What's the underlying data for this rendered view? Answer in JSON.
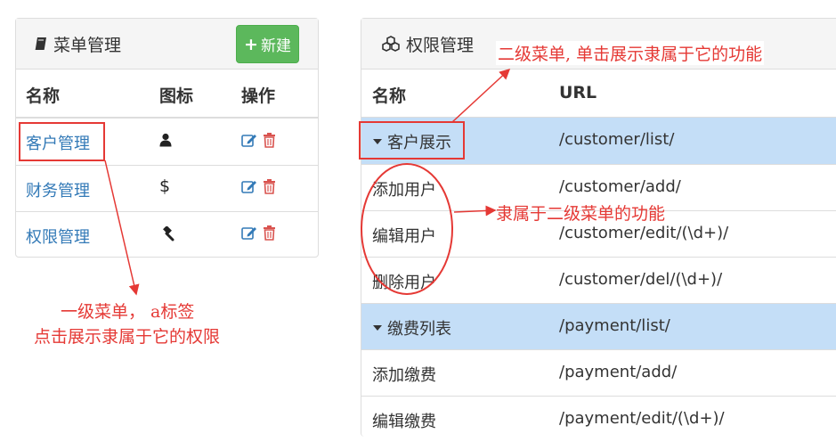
{
  "menu_panel": {
    "title": "菜单管理",
    "title_icon": "book-icon",
    "new_button_label": "新建",
    "columns": [
      "名称",
      "图标",
      "操作"
    ],
    "rows": [
      {
        "name": "客户管理",
        "icon": "user-icon"
      },
      {
        "name": "财务管理",
        "icon": "dollar-icon"
      },
      {
        "name": "权限管理",
        "icon": "gavel-icon"
      }
    ]
  },
  "permission_panel": {
    "title": "权限管理",
    "title_icon": "cubes-icon",
    "columns": [
      "名称",
      "URL"
    ],
    "rows": [
      {
        "name": "客户展示",
        "url": "/customer/list/",
        "type": "group"
      },
      {
        "name": "添加用户",
        "url": "/customer/add/",
        "type": "item"
      },
      {
        "name": "编辑用户",
        "url": "/customer/edit/(\\d+)/",
        "type": "item"
      },
      {
        "name": "删除用户",
        "url": "/customer/del/(\\d+)/",
        "type": "item"
      },
      {
        "name": "缴费列表",
        "url": "/payment/list/",
        "type": "group"
      },
      {
        "name": "添加缴费",
        "url": "/payment/add/",
        "type": "item"
      },
      {
        "name": "编辑缴费",
        "url": "/payment/edit/(\\d+)/",
        "type": "item"
      }
    ]
  },
  "annotations": {
    "level1_line1": "一级菜单， a标签",
    "level1_line2": "点击展示隶属于它的权限",
    "level2": "二级菜单, 单击展示隶属于它的功能",
    "functions": "隶属于二级菜单的功能"
  },
  "colors": {
    "link": "#337ab7",
    "highlight": "#c4def7",
    "annotation": "#e53935",
    "new_button": "#5cb85c",
    "delete_icon": "#d9534f"
  }
}
